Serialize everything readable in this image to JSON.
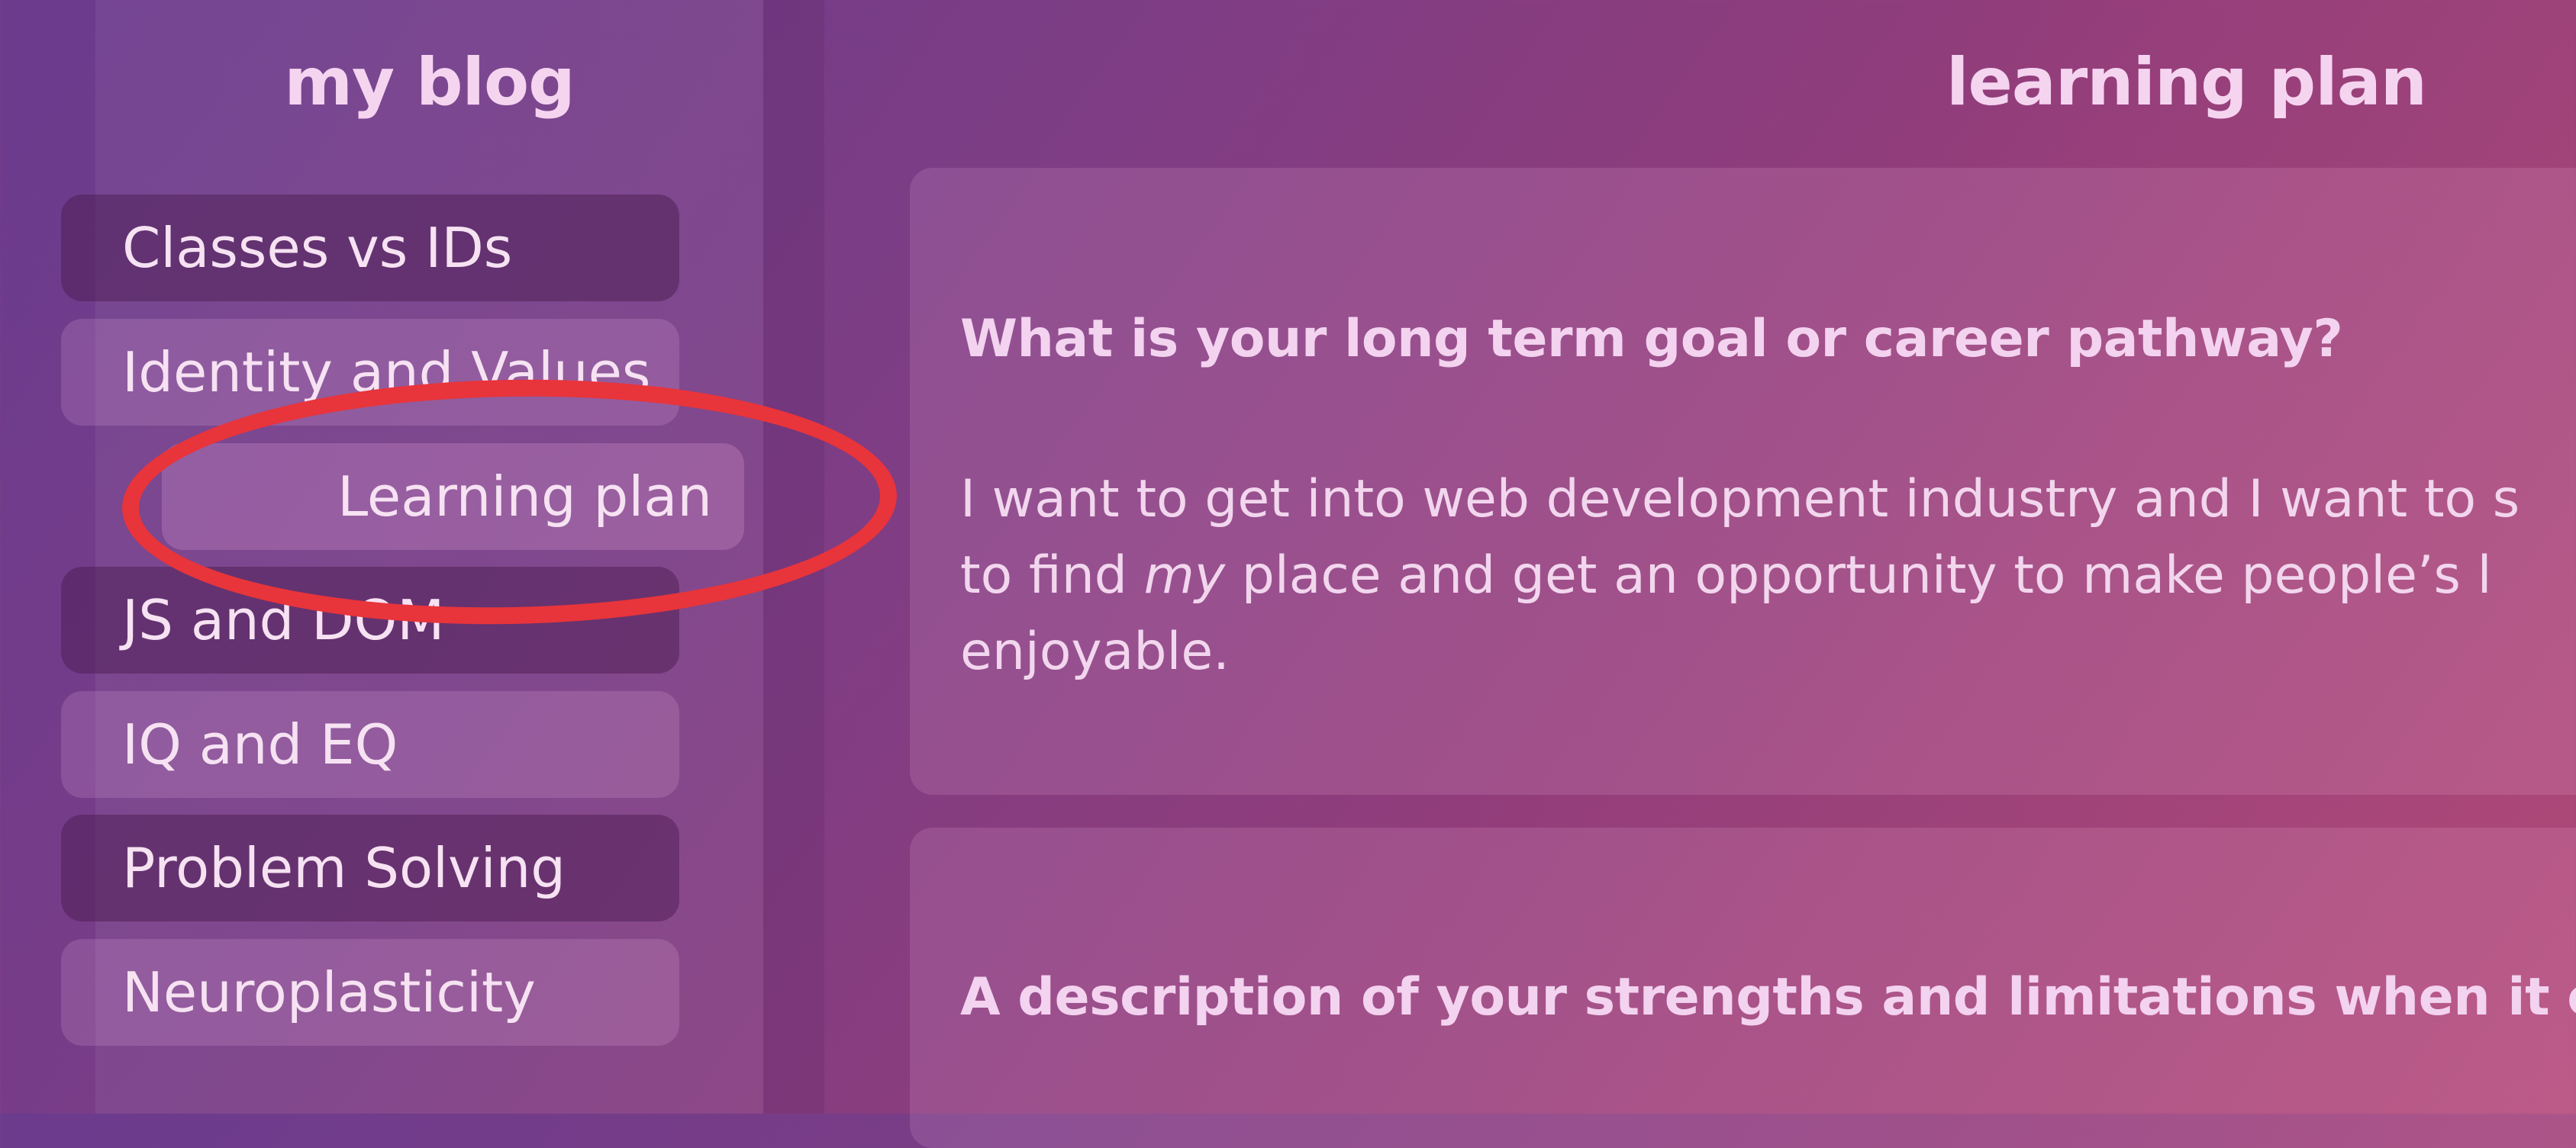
{
  "sidebar": {
    "blog_title": "my blog",
    "items": [
      {
        "label": "Classes vs IDs"
      },
      {
        "label": "Identity and Values"
      },
      {
        "label": "Learning plan"
      },
      {
        "label": "JS and DOM"
      },
      {
        "label": "IQ and EQ"
      },
      {
        "label": "Problem Solving"
      },
      {
        "label": "Neuroplasticity"
      }
    ],
    "active_item": "Learning plan"
  },
  "main": {
    "heading": "learning plan",
    "cards": [
      {
        "question": "What is your long term goal or career pathway?",
        "answer": {
          "line1": "I want to get into web development industry and I want to s",
          "line2_pre": "to find ",
          "line2_em": "my",
          "line2_post": " place and get an opportunity to make people’s l",
          "line3": "enjoyable."
        }
      },
      {
        "question": "A description of your strengths and limitations when it come"
      }
    ]
  },
  "annotation": {
    "type": "ellipse",
    "color": "#e8343b",
    "target": "Learning plan"
  }
}
